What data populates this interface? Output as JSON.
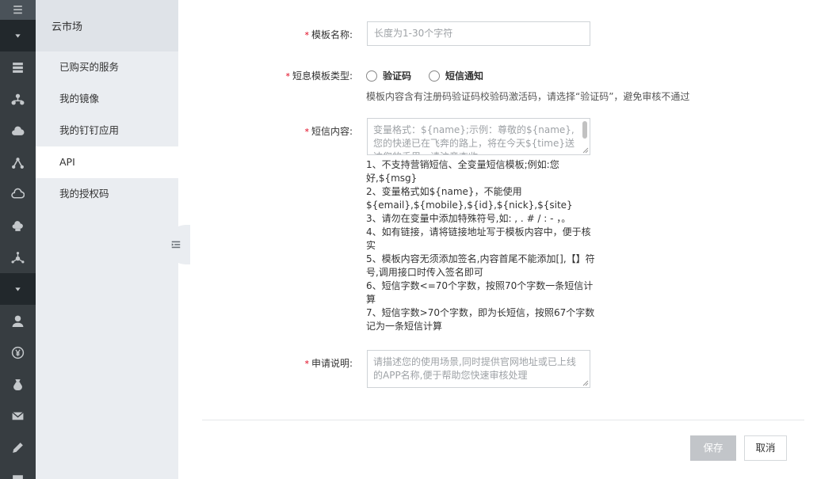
{
  "rail": {
    "icons": [
      "menu-icon",
      "chevron-down-icon",
      "database-icon",
      "network-icon",
      "cloud-upload-icon",
      "branch-icon",
      "cloud-icon",
      "cloud-hand-icon",
      "hub-icon",
      "chevron-down-icon",
      "user-icon",
      "yen-icon",
      "money-bag-icon",
      "mail-icon",
      "pencil-icon",
      "chat-icon"
    ]
  },
  "sidebar": {
    "title": "云市场",
    "items": [
      {
        "label": "已购买的服务"
      },
      {
        "label": "我的镜像"
      },
      {
        "label": "我的钉钉应用"
      },
      {
        "label": "API"
      },
      {
        "label": "我的授权码"
      }
    ]
  },
  "form": {
    "template_name": {
      "label": "模板名称:",
      "placeholder": "长度为1-30个字符"
    },
    "template_type": {
      "label": "短息模板类型:",
      "options": [
        "验证码",
        "短信通知"
      ],
      "hint": "模板内容含有注册码验证码校验码激活码，请选择“验证码”，避免审核不通过"
    },
    "content": {
      "label": "短信内容:",
      "placeholder": "变量格式：${name};示例：尊敬的${name},您的快递已在飞奔的路上，将在今天${time}送达您的手里，请注意查收。",
      "rules": [
        "1、不支持营销短信、全变量短信模板;例如:您好,${msg}",
        "2、变量格式如${name}，不能使用${email},${mobile},${id},${nick},${site}",
        "3、请勿在变量中添加特殊符号,如: , . # / : - ，。",
        "4、如有链接，请将链接地址写于模板内容中，便于核实",
        "5、模板内容无须添加签名,内容首尾不能添加[],【】符号,调用接口时传入签名即可",
        "6、短信字数<=70个字数，按照70个字数一条短信计算",
        "7、短信字数>70个字数，即为长短信，按照67个字数记为一条短信计算"
      ]
    },
    "description": {
      "label": "申请说明:",
      "placeholder": "请描述您的使用场景,同时提供官网地址或已上线的APP名称,便于帮助您快速审核处理"
    },
    "required_mark": "*"
  },
  "actions": {
    "save": "保存",
    "cancel": "取消"
  }
}
